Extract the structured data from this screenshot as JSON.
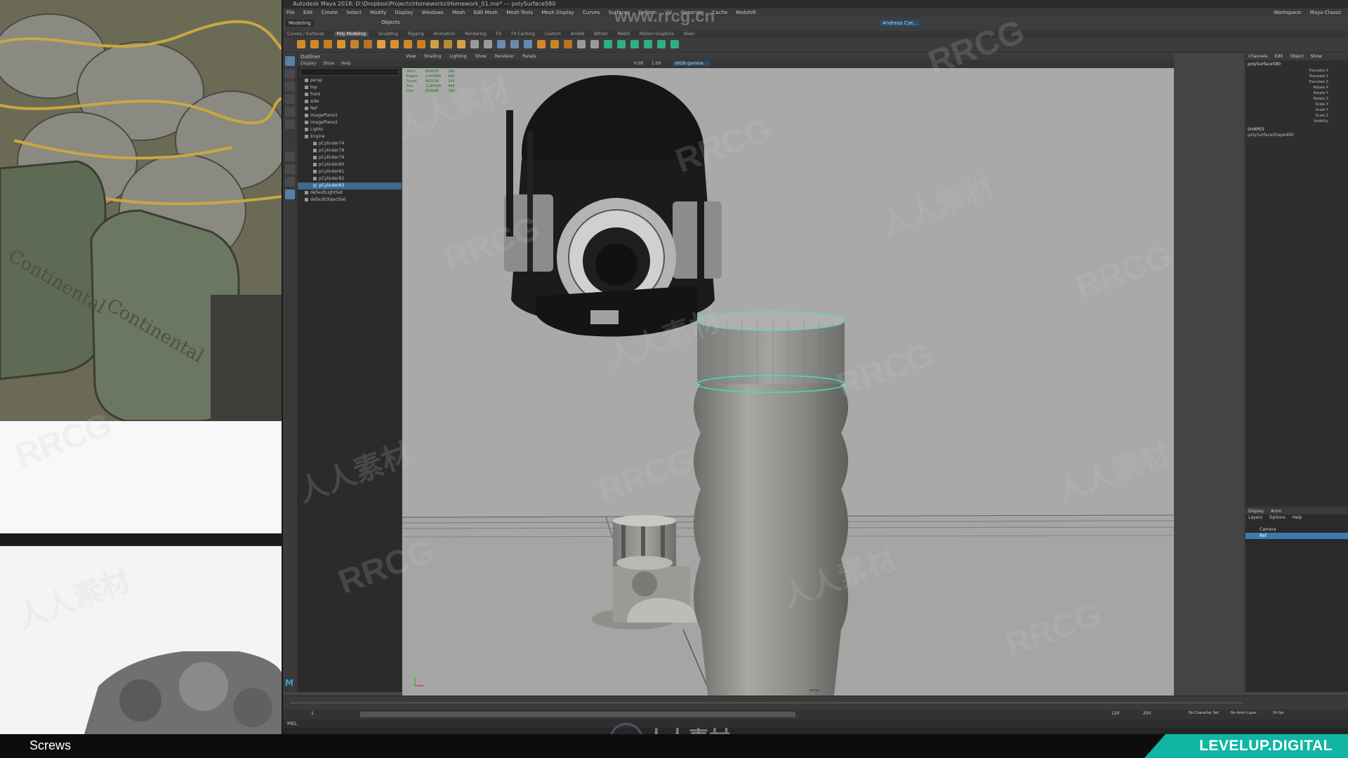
{
  "window": {
    "title": "Autodesk Maya 2018: D:\\Dropbox\\Projects\\Homeworks\\Homework_01.ma* --- polySurface580",
    "menus": [
      "File",
      "Edit",
      "Create",
      "Select",
      "Modify",
      "Display",
      "Windows",
      "Mesh",
      "Edit Mesh",
      "Mesh Tools",
      "Mesh Display",
      "Curves",
      "Surfaces",
      "Deform",
      "UV",
      "Generate",
      "Cache",
      "Redshift"
    ],
    "workspace_label": "Workspace:",
    "workspace_value": "Maya Classic",
    "user": "Andreas Cze..."
  },
  "status_line": {
    "mode": "Modeling",
    "objects_label": "Objects"
  },
  "shelf_tabs": {
    "items": [
      "Curves / Surfaces",
      "Poly Modeling",
      "Sculpting",
      "Rigging",
      "Animation",
      "Rendering",
      "FX",
      "FX Caching",
      "Custom",
      "Arnold",
      "Bifrost",
      "MASH",
      "Motion Graphics",
      "XGen"
    ],
    "active": "Poly Modeling"
  },
  "outliner": {
    "title": "Outliner",
    "menu": [
      "Display",
      "Show",
      "Help"
    ],
    "rows": [
      {
        "label": "persp",
        "selected": false
      },
      {
        "label": "top",
        "selected": false
      },
      {
        "label": "front",
        "selected": false
      },
      {
        "label": "side",
        "selected": false
      },
      {
        "label": "Ref",
        "selected": false
      },
      {
        "label": "imagePlane1",
        "selected": false
      },
      {
        "label": "imagePlane2",
        "selected": false
      },
      {
        "label": "Lights",
        "selected": false
      },
      {
        "label": "Engine",
        "selected": false
      },
      {
        "label": "pCylinder74",
        "selected": false
      },
      {
        "label": "pCylinder78",
        "selected": false
      },
      {
        "label": "pCylinder79",
        "selected": false
      },
      {
        "label": "pCylinder80",
        "selected": false
      },
      {
        "label": "pCylinder81",
        "selected": false
      },
      {
        "label": "pCylinder82",
        "selected": false
      },
      {
        "label": "pCylinder83",
        "selected": true
      },
      {
        "label": "defaultLightSet",
        "selected": false
      },
      {
        "label": "defaultObjectSet",
        "selected": false
      }
    ]
  },
  "viewport": {
    "menu": [
      "View",
      "Shading",
      "Lighting",
      "Show",
      "Renderer",
      "Panels"
    ],
    "camera_label": "persp",
    "hud": [
      {
        "name": "Verts:",
        "value": "806658",
        "sel": "280"
      },
      {
        "name": "Edges:",
        "value": "1408888",
        "sel": "560"
      },
      {
        "name": "Faces:",
        "value": "602528",
        "sel": "240"
      },
      {
        "name": "Tris:",
        "value": "1195588",
        "sel": "480"
      },
      {
        "name": "UVs:",
        "value": "855888",
        "sel": "280"
      }
    ],
    "field_a": "0.00",
    "field_b": "1.00",
    "color_space": "sRGB gamma"
  },
  "channel_box": {
    "tabs": [
      "Channels",
      "Edit",
      "Object",
      "Show"
    ],
    "object_name": "polySurface580",
    "attrs": [
      "Translate X",
      "Translate Y",
      "Translate Z",
      "Rotate X",
      "Rotate Y",
      "Rotate Z",
      "Scale X",
      "Scale Y",
      "Scale Z",
      "Visibility"
    ],
    "shapes_label": "SHAPES",
    "shape_name": "polySurfaceShape490"
  },
  "layer_editor": {
    "tabs": [
      "Display",
      "Anim"
    ],
    "menu": [
      "Layers",
      "Options",
      "Help"
    ],
    "layers": [
      {
        "label": "Camera",
        "selected": false
      },
      {
        "label": "Ref",
        "selected": true
      }
    ]
  },
  "time": {
    "start": "1",
    "end": "120",
    "range_end": "200",
    "character_set": "No Character Set",
    "anim_layer": "No Anim Layer",
    "fps": "24 fps",
    "cmd_label": "MEL"
  },
  "overlay": {
    "caption": "Screws",
    "brand": "LEVELUP.DIGITAL",
    "watermark_url": "www.rrcg.cn",
    "watermark_bottom": "人人素材",
    "watermark_text": "RRCG",
    "watermark_cn": "人人素材",
    "ref_logo_text": "Continental"
  },
  "colors": {
    "maya_bg": "#444444",
    "viewport_bg": "#a9a9a9",
    "selection": "#3d6a8f",
    "brand": "#11b5a4"
  }
}
